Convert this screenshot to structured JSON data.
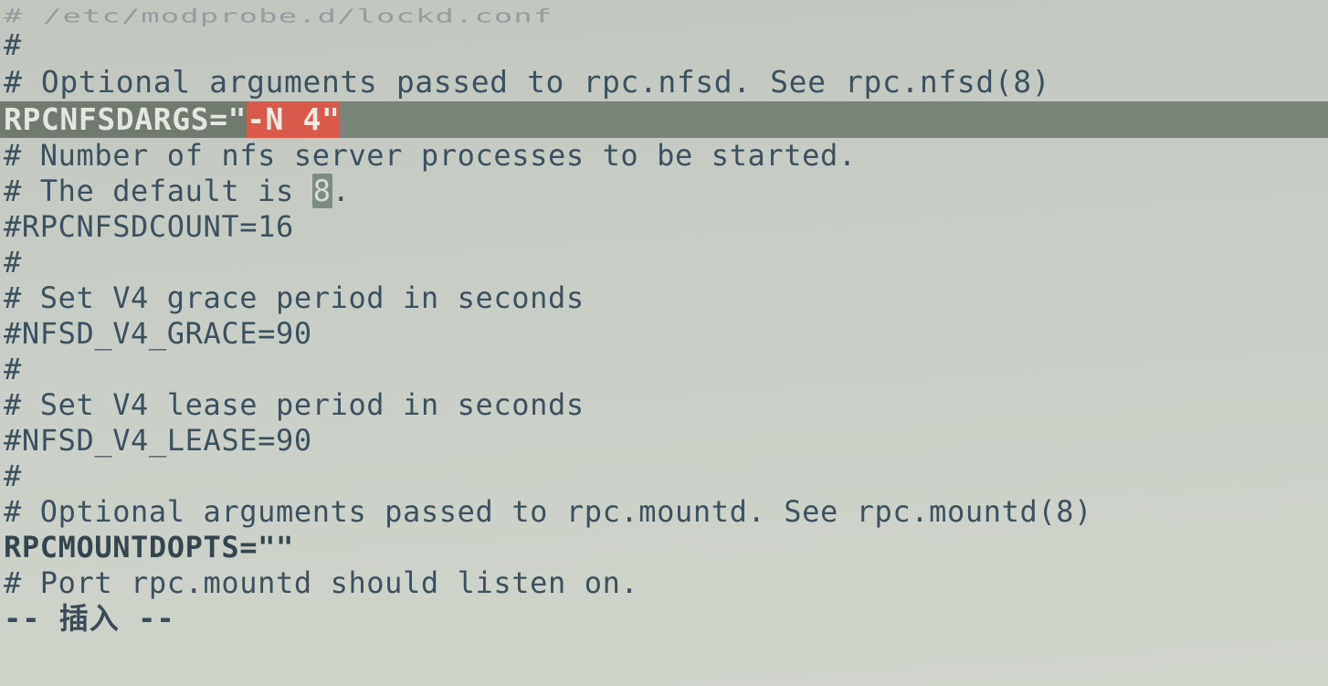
{
  "lines": {
    "cutoff": "# /etc/modprobe.d/lockd.conf",
    "l1": "#",
    "blank1": "",
    "l2": "# Optional arguments passed to rpc.nfsd. See rpc.nfsd(8)",
    "l3_a": "RPCNFSDARGS=\"",
    "l3_b": "-N 4\"",
    "blank2": "",
    "l4": "# Number of nfs server processes to be started.",
    "l5_a": "# The default is ",
    "l5_hl": "8",
    "l5_b": ".",
    "l6": "#RPCNFSDCOUNT=16",
    "l7": "#",
    "l8": "# Set V4 grace period in seconds",
    "l9": "#NFSD_V4_GRACE=90",
    "l10": "#",
    "l11": "# Set V4 lease period in seconds",
    "l12": "#NFSD_V4_LEASE=90",
    "l13": "#",
    "l14": "# Optional arguments passed to rpc.mountd. See rpc.mountd(8)",
    "l15": "RPCMOUNTDOPTS=\"\"",
    "l16": "# Port rpc.mountd should listen on.",
    "status": "-- 插入 --"
  }
}
